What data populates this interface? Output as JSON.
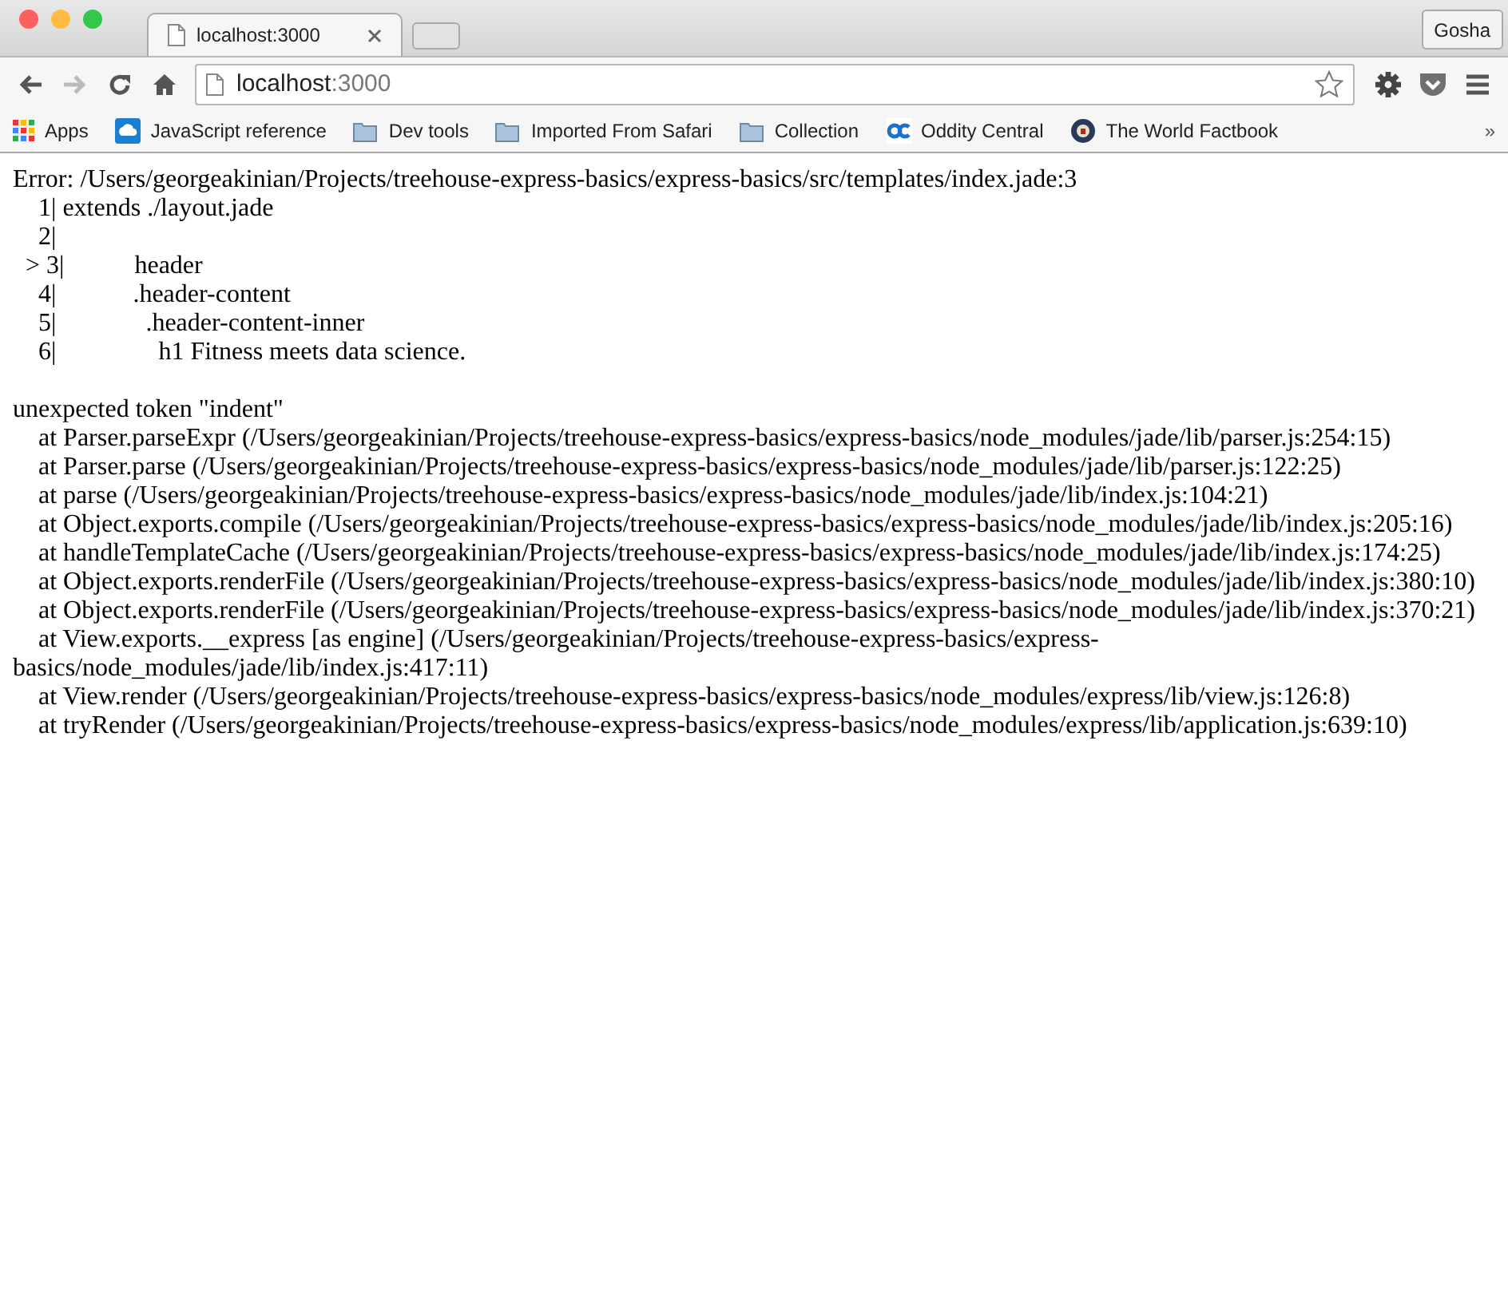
{
  "tabs": [
    {
      "title": "localhost:3000",
      "selected": true
    }
  ],
  "profile_button": "Gosha",
  "toolbar": {
    "back_disabled": false,
    "forward_disabled": true
  },
  "address": {
    "host": "localhost",
    "port": ":3000"
  },
  "bookmarks": [
    {
      "label": "Apps",
      "kind": "apps"
    },
    {
      "label": "JavaScript reference",
      "kind": "site"
    },
    {
      "label": "Dev tools",
      "kind": "folder"
    },
    {
      "label": "Imported From Safari",
      "kind": "folder"
    },
    {
      "label": "Collection",
      "kind": "folder"
    },
    {
      "label": "Oddity Central",
      "kind": "oddity"
    },
    {
      "label": "The World Factbook",
      "kind": "seal"
    }
  ],
  "bookmarks_overflow": "»",
  "page": {
    "source_lines": [
      "Error: /Users/georgeakinian/Projects/treehouse-express-basics/express-basics/src/templates/index.jade:3",
      "    1| extends ./layout.jade",
      "    2| ",
      "  > 3|           header",
      "    4|            .header-content",
      "    5|              .header-content-inner",
      "    6|                h1 Fitness meets data science."
    ],
    "trace_lines": [
      "unexpected token \"indent\"",
      "    at Parser.parseExpr (/Users/georgeakinian/Projects/treehouse-express-basics/express-basics/node_modules/jade/lib/parser.js:254:15)",
      "    at Parser.parse (/Users/georgeakinian/Projects/treehouse-express-basics/express-basics/node_modules/jade/lib/parser.js:122:25)",
      "    at parse (/Users/georgeakinian/Projects/treehouse-express-basics/express-basics/node_modules/jade/lib/index.js:104:21)",
      "    at Object.exports.compile (/Users/georgeakinian/Projects/treehouse-express-basics/express-basics/node_modules/jade/lib/index.js:205:16)",
      "    at handleTemplateCache (/Users/georgeakinian/Projects/treehouse-express-basics/express-basics/node_modules/jade/lib/index.js:174:25)",
      "    at Object.exports.renderFile (/Users/georgeakinian/Projects/treehouse-express-basics/express-basics/node_modules/jade/lib/index.js:380:10)",
      "    at Object.exports.renderFile (/Users/georgeakinian/Projects/treehouse-express-basics/express-basics/node_modules/jade/lib/index.js:370:21)",
      "    at View.exports.__express [as engine] (/Users/georgeakinian/Projects/treehouse-express-basics/express-basics/node_modules/jade/lib/index.js:417:11)",
      "    at View.render (/Users/georgeakinian/Projects/treehouse-express-basics/express-basics/node_modules/express/lib/view.js:126:8)",
      "    at tryRender (/Users/georgeakinian/Projects/treehouse-express-basics/express-basics/node_modules/express/lib/application.js:639:10)"
    ]
  }
}
